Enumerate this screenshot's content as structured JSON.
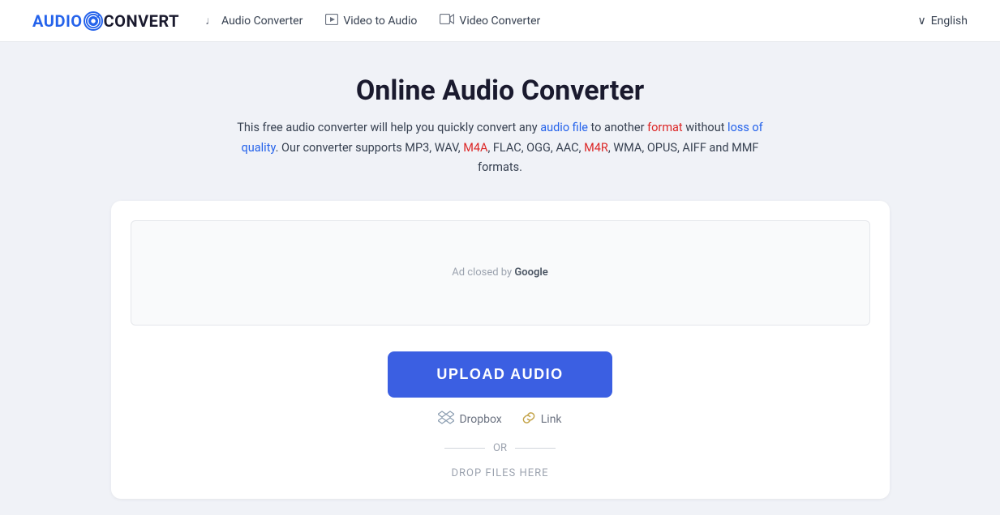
{
  "header": {
    "logo_audio": "AUDIO",
    "logo_convert": "CONVERT",
    "nav": [
      {
        "id": "audio-converter",
        "label": "Audio Converter",
        "icon": "♩"
      },
      {
        "id": "video-to-audio",
        "label": "Video to Audio",
        "icon": "▶"
      },
      {
        "id": "video-converter",
        "label": "Video Converter",
        "icon": "▭"
      }
    ],
    "language_label": "English",
    "language_chevron": "∨"
  },
  "main": {
    "title": "Online Audio Converter",
    "subtitle_plain": "This free audio converter will help you quickly convert any audio file to another format without loss of quality. Our converter supports MP3, WAV, M4A, FLAC, OGG, AAC, M4R, WMA, OPUS, AIFF and MMF formats.",
    "ad_label": "Ad closed by",
    "ad_google": "Google",
    "upload_button": "UPLOAD AUDIO",
    "dropbox_label": "Dropbox",
    "link_label": "Link",
    "or_label": "OR",
    "drop_files_label": "DROP FILES HERE"
  }
}
